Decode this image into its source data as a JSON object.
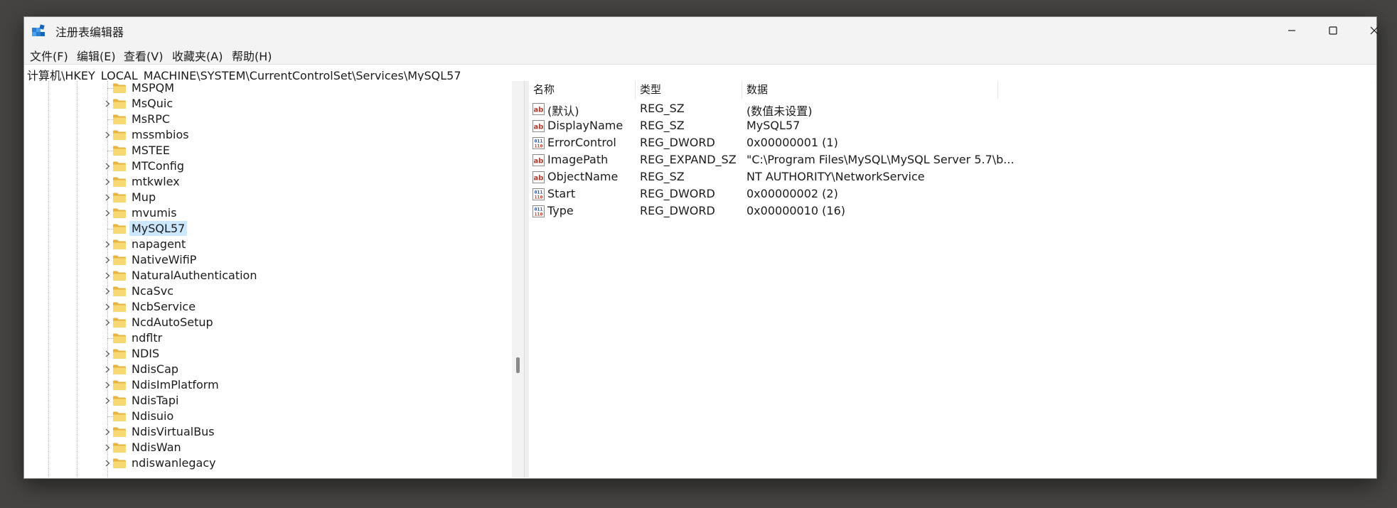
{
  "window": {
    "title": "注册表编辑器"
  },
  "menu": [
    "文件(F)",
    "编辑(E)",
    "查看(V)",
    "收藏夹(A)",
    "帮助(H)"
  ],
  "address": "计算机\\HKEY_LOCAL_MACHINE\\SYSTEM\\CurrentControlSet\\Services\\MySQL57",
  "tree": {
    "items": [
      {
        "label": "MSPQM",
        "expandable": false
      },
      {
        "label": "MsQuic",
        "expandable": true
      },
      {
        "label": "MsRPC",
        "expandable": false
      },
      {
        "label": "mssmbios",
        "expandable": true
      },
      {
        "label": "MSTEE",
        "expandable": false
      },
      {
        "label": "MTConfig",
        "expandable": true
      },
      {
        "label": "mtkwlex",
        "expandable": true
      },
      {
        "label": "Mup",
        "expandable": true
      },
      {
        "label": "mvumis",
        "expandable": true
      },
      {
        "label": "MySQL57",
        "expandable": false,
        "selected": true
      },
      {
        "label": "napagent",
        "expandable": true
      },
      {
        "label": "NativeWifiP",
        "expandable": true
      },
      {
        "label": "NaturalAuthentication",
        "expandable": true
      },
      {
        "label": "NcaSvc",
        "expandable": true
      },
      {
        "label": "NcbService",
        "expandable": true
      },
      {
        "label": "NcdAutoSetup",
        "expandable": true
      },
      {
        "label": "ndfltr",
        "expandable": false
      },
      {
        "label": "NDIS",
        "expandable": true
      },
      {
        "label": "NdisCap",
        "expandable": true
      },
      {
        "label": "NdisImPlatform",
        "expandable": true
      },
      {
        "label": "NdisTapi",
        "expandable": true
      },
      {
        "label": "Ndisuio",
        "expandable": false
      },
      {
        "label": "NdisVirtualBus",
        "expandable": true
      },
      {
        "label": "NdisWan",
        "expandable": true
      },
      {
        "label": "ndiswanlegacy",
        "expandable": true
      }
    ]
  },
  "list": {
    "columns": [
      "名称",
      "类型",
      "数据"
    ],
    "rows": [
      {
        "icon": "string-value-icon",
        "name": "(默认)",
        "type": "REG_SZ",
        "data": "(数值未设置)"
      },
      {
        "icon": "string-value-icon",
        "name": "DisplayName",
        "type": "REG_SZ",
        "data": "MySQL57"
      },
      {
        "icon": "binary-value-icon",
        "name": "ErrorControl",
        "type": "REG_DWORD",
        "data": "0x00000001 (1)"
      },
      {
        "icon": "string-value-icon",
        "name": "ImagePath",
        "type": "REG_EXPAND_SZ",
        "data": "\"C:\\Program Files\\MySQL\\MySQL Server 5.7\\b..."
      },
      {
        "icon": "string-value-icon",
        "name": "ObjectName",
        "type": "REG_SZ",
        "data": "NT AUTHORITY\\NetworkService"
      },
      {
        "icon": "binary-value-icon",
        "name": "Start",
        "type": "REG_DWORD",
        "data": "0x00000002 (2)"
      },
      {
        "icon": "binary-value-icon",
        "name": "Type",
        "type": "REG_DWORD",
        "data": "0x00000010 (16)"
      }
    ]
  },
  "colors": {
    "selection": "#cce8ff",
    "folder": "#f8d775",
    "accent": "#0078d4"
  }
}
